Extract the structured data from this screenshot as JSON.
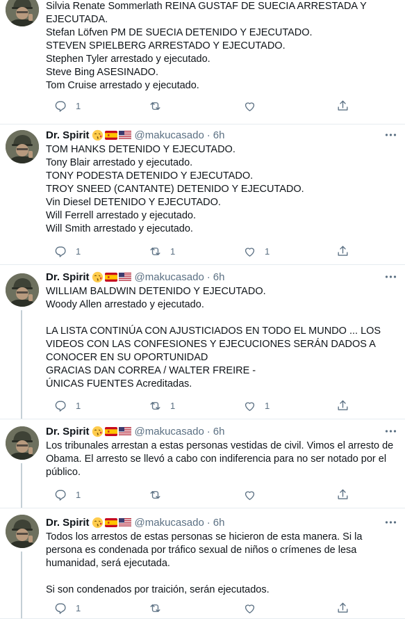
{
  "tweets": [
    {
      "show_header": false,
      "name": "",
      "handle": "",
      "time": "",
      "lines": [
        "Silvia Renate Sommerlath REINA GUSTAF DE SUECIA ARRESTADA Y",
        "EJECUTADA.",
        "Stefan Löfven PM DE SUECIA DETENIDO Y EJECUTADO.",
        "STEVEN SPIELBERG ARRESTADO Y EJECUTADO.",
        "Stephen Tyler arrestado y ejecutado.",
        "Steve Bing ASESINADO.",
        "Tom Cruise arrestado y ejecutado."
      ],
      "replies": "1",
      "retweets": "",
      "likes": ""
    },
    {
      "show_header": true,
      "name": "Dr. Spirit",
      "handle": "@makucasado",
      "time": "6h",
      "lines": [
        "TOM HANKS DETENIDO Y EJECUTADO.",
        "Tony Blair arrestado y ejecutado.",
        "TONY PODESTA DETENIDO Y EJECUTADO.",
        "TROY SNEED (CANTANTE) DETENIDO Y EJECUTADO.",
        "Vin Diesel DETENIDO Y EJECUTADO.",
        "Will Ferrell arrestado y ejecutado.",
        "Will Smith arrestado y ejecutado."
      ],
      "replies": "1",
      "retweets": "1",
      "likes": "1"
    },
    {
      "show_header": true,
      "name": "Dr. Spirit",
      "handle": "@makucasado",
      "time": "6h",
      "lines": [
        "WILLIAM BALDWIN DETENIDO Y EJECUTADO.",
        "Woody Allen arrestado y ejecutado.",
        "",
        "LA LISTA CONTINÚA CON AJUSTICIADOS EN TODO EL MUNDO ... LOS",
        "VIDEOS CON LAS CONFESIONES Y EJECUCIONES SERÁN DADOS A",
        "CONOCER EN SU OPORTUNIDAD",
        "GRACIAS DAN CORREA / WALTER FREIRE  -",
        "ÚNICAS FUENTES Acreditadas."
      ],
      "replies": "1",
      "retweets": "1",
      "likes": "1"
    },
    {
      "show_header": true,
      "name": "Dr. Spirit",
      "handle": "@makucasado",
      "time": "6h",
      "lines": [
        "Los tribunales arrestan a estas personas vestidas de civil. Vimos el arresto de",
        "Obama. El arresto se llevó a cabo con indiferencia para no ser notado por el",
        "público."
      ],
      "replies": "1",
      "retweets": "",
      "likes": ""
    },
    {
      "show_header": true,
      "name": "Dr. Spirit",
      "handle": "@makucasado",
      "time": "6h",
      "lines": [
        "Todos los arrestos de estas personas se hicieron de esta manera. Si la",
        "persona es condenada por tráfico sexual de niños o crímenes de lesa",
        "humanidad, será ejecutada.",
        "",
        "Si son condenados por traición, serán ejecutados."
      ],
      "replies": "1",
      "retweets": "",
      "likes": ""
    }
  ],
  "icons": {
    "emoji": "kissing-face-emoji",
    "flag1": "spain-flag-icon",
    "flag2": "usa-flag-icon",
    "more": "more-icon",
    "reply": "reply-icon",
    "retweet": "retweet-icon",
    "like": "like-icon",
    "share": "share-icon"
  },
  "colors": {
    "text": "#0f1419",
    "secondary": "#5b7083",
    "divider": "#e6ecf0",
    "thread": "#c4cfd6"
  }
}
